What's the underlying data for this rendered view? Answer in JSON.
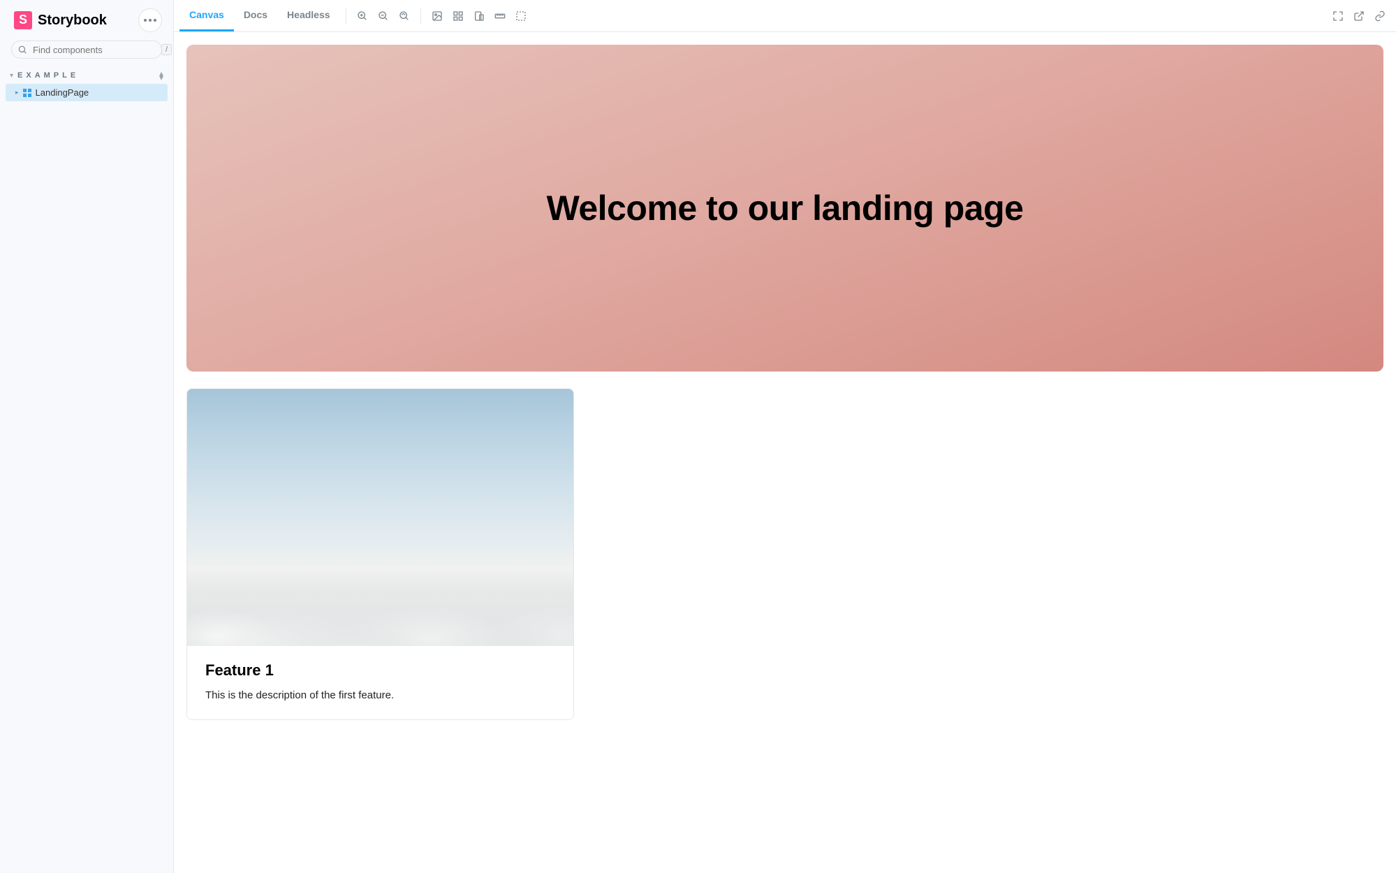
{
  "app": {
    "name": "Storybook"
  },
  "sidebar": {
    "search_placeholder": "Find components",
    "search_shortcut": "/",
    "section_label": "EXAMPLE",
    "items": [
      {
        "label": "LandingPage"
      }
    ]
  },
  "tabs": [
    {
      "label": "Canvas",
      "active": true
    },
    {
      "label": "Docs",
      "active": false
    },
    {
      "label": "Headless",
      "active": false
    }
  ],
  "story": {
    "hero_title": "Welcome to our landing page",
    "features": [
      {
        "title": "Feature 1",
        "description": "This is the description of the first feature."
      }
    ]
  }
}
